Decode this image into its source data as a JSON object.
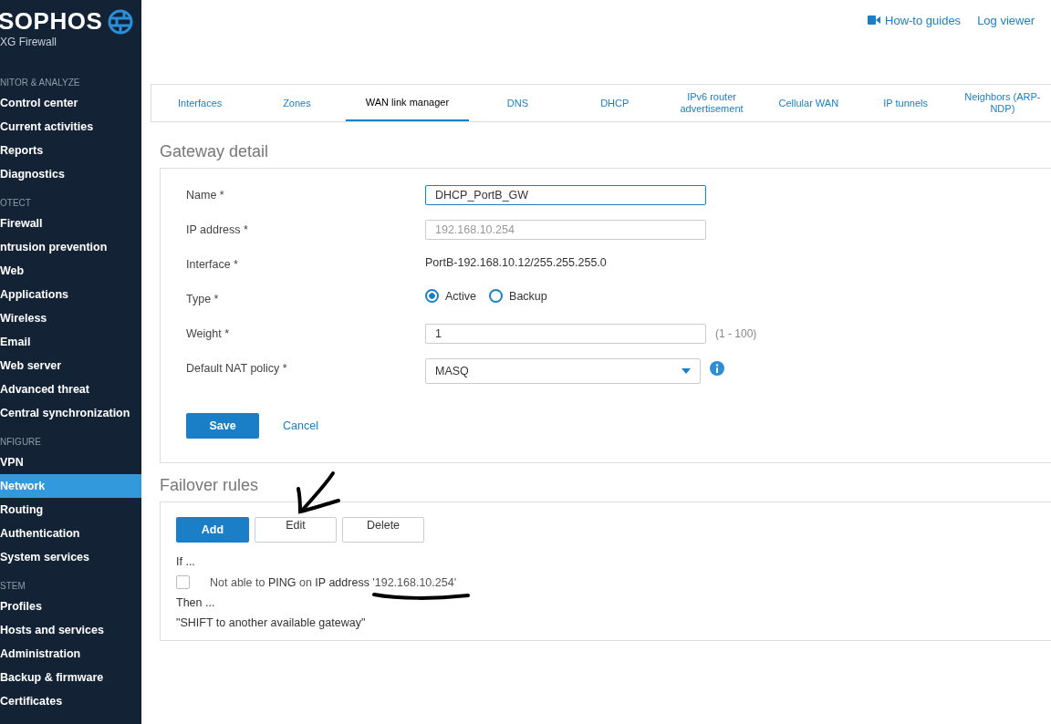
{
  "sidebar": {
    "logo": "SOPHOS",
    "product": "XG Firewall",
    "sections": [
      {
        "heading": "NITOR & ANALYZE",
        "items": [
          {
            "label": "Control center",
            "selected": false
          },
          {
            "label": "Current activities",
            "selected": false
          },
          {
            "label": "Reports",
            "selected": false
          },
          {
            "label": "Diagnostics",
            "selected": false
          }
        ]
      },
      {
        "heading": "OTECT",
        "items": [
          {
            "label": "Firewall",
            "selected": false
          },
          {
            "label": "ntrusion prevention",
            "selected": false
          },
          {
            "label": "Web",
            "selected": false
          },
          {
            "label": "Applications",
            "selected": false
          },
          {
            "label": "Wireless",
            "selected": false
          },
          {
            "label": "Email",
            "selected": false
          },
          {
            "label": "Web server",
            "selected": false
          },
          {
            "label": "Advanced threat",
            "selected": false
          },
          {
            "label": "Central synchronization",
            "selected": false
          }
        ]
      },
      {
        "heading": "NFIGURE",
        "items": [
          {
            "label": "VPN",
            "selected": false
          },
          {
            "label": "Network",
            "selected": true
          },
          {
            "label": "Routing",
            "selected": false
          },
          {
            "label": "Authentication",
            "selected": false
          },
          {
            "label": "System services",
            "selected": false
          }
        ]
      },
      {
        "heading": "STEM",
        "items": [
          {
            "label": "Profiles",
            "selected": false
          },
          {
            "label": "Hosts and services",
            "selected": false
          },
          {
            "label": "Administration",
            "selected": false
          },
          {
            "label": "Backup & firmware",
            "selected": false
          },
          {
            "label": "Certificates",
            "selected": false
          }
        ]
      }
    ]
  },
  "top_links": [
    "How-to guides",
    "Log viewer"
  ],
  "tabs": [
    {
      "label": "Interfaces",
      "selected": false
    },
    {
      "label": "Zones",
      "selected": false
    },
    {
      "label": "WAN link manager",
      "selected": true
    },
    {
      "label": "DNS",
      "selected": false
    },
    {
      "label": "DHCP",
      "selected": false
    },
    {
      "label": "IPv6 router advertisement",
      "selected": false
    },
    {
      "label": "Cellular WAN",
      "selected": false
    },
    {
      "label": "IP tunnels",
      "selected": false
    },
    {
      "label": "Neighbors (ARP-NDP)",
      "selected": false
    }
  ],
  "gateway_detail": {
    "title": "Gateway detail",
    "fields": [
      {
        "kind": "input",
        "label": "Name *",
        "value": "DHCP_PortB_GW",
        "focused": true
      },
      {
        "kind": "placeholder",
        "label": "IP address *",
        "placeholder": "192.168.10.254"
      },
      {
        "kind": "text",
        "label": "Interface *",
        "value": "PortB-192.168.10.12/255.255.255.0"
      },
      {
        "kind": "radio",
        "label": "Type *",
        "options": [
          {
            "label": "Active",
            "selected": true
          },
          {
            "label": "Backup",
            "selected": false
          }
        ]
      },
      {
        "kind": "input",
        "label": "Weight *",
        "value": "1",
        "focused": false,
        "hint": "(1 - 100)"
      },
      {
        "kind": "select",
        "label": "Default NAT policy *",
        "value": "MASQ"
      }
    ],
    "buttons": [
      "Save",
      "Cancel"
    ]
  },
  "failover_rules": {
    "title": "Failover rules",
    "buttons": [
      "Add",
      "Edit",
      "Delete"
    ],
    "if_label": "If ...",
    "rule": {
      "checked": false,
      "text": "Not able to **PING** on **IP address** '192.168.10.254'"
    },
    "then_label": "Then ...",
    "action": "\"SHIFT to another available gateway\""
  }
}
